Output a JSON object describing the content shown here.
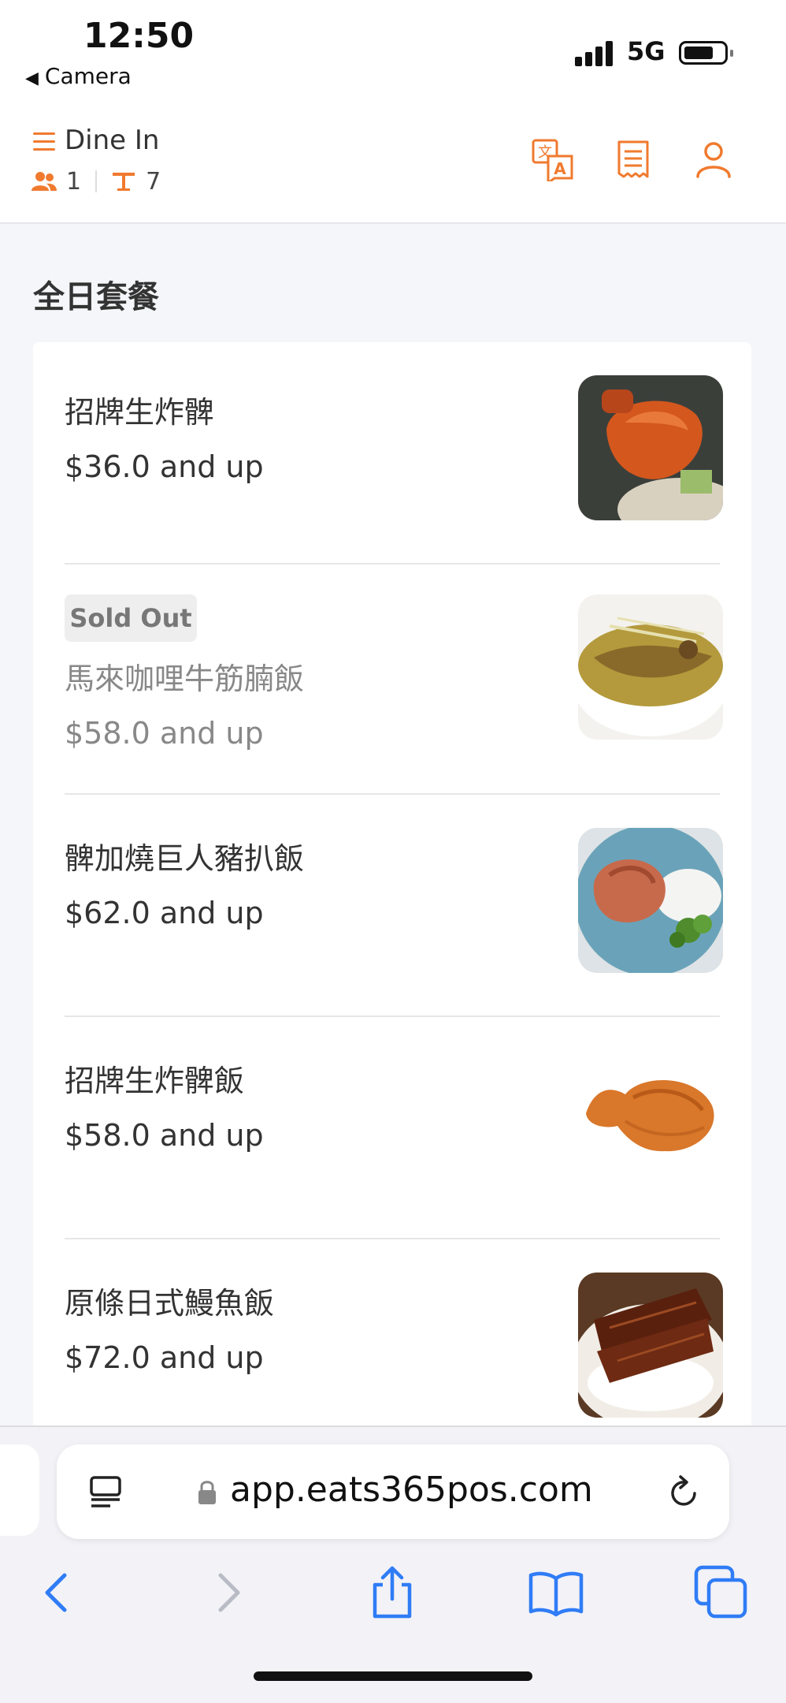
{
  "status_bar": {
    "time": "12:50",
    "back_app": "Camera",
    "network": "5G"
  },
  "header": {
    "mode": "Dine In",
    "guests": "1",
    "table": "7",
    "icons": [
      "menu-icon",
      "translate-icon",
      "receipt-icon",
      "user-icon"
    ]
  },
  "category": {
    "title": "全日套餐"
  },
  "items": [
    {
      "name": "招牌生炸髀",
      "price": "$36.0 and up",
      "sold_out": false
    },
    {
      "name": "馬來咖哩牛筋腩飯",
      "price": "$58.0 and up",
      "sold_out": true,
      "badge": "Sold Out"
    },
    {
      "name": "髀加燒巨人豬扒飯",
      "price": "$62.0 and up",
      "sold_out": false
    },
    {
      "name": "招牌生炸髀飯",
      "price": "$58.0 and up",
      "sold_out": false
    },
    {
      "name": "原條日式鰻魚飯",
      "price": "$72.0 and up",
      "sold_out": false
    }
  ],
  "browser": {
    "url": "app.eats365pos.com",
    "toolbar": [
      "back-icon",
      "forward-icon",
      "share-icon",
      "bookmarks-icon",
      "tabs-icon"
    ]
  },
  "colors": {
    "accent": "#f07a2e",
    "browser_blue": "#2f7cf6"
  }
}
